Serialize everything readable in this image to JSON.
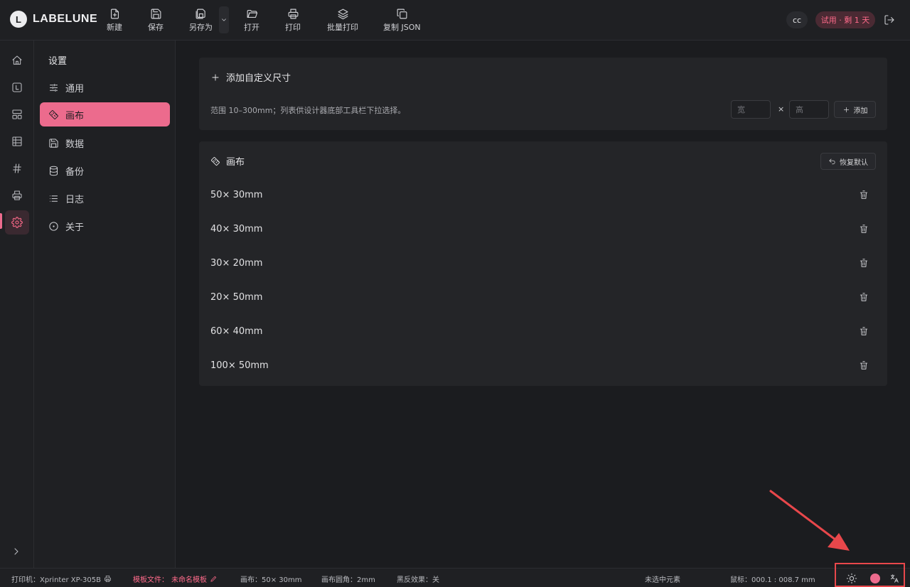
{
  "app": {
    "logo_text": "LABELUNE",
    "logo_letter": "L"
  },
  "toolbar": {
    "new_label": "新建",
    "save_label": "保存",
    "save_as_label": "另存为",
    "open_label": "打开",
    "print_label": "打印",
    "batch_print_label": "批量打印",
    "copy_json_label": "复制 JSON"
  },
  "header": {
    "avatar_text": "cc",
    "trial_badge": "试用 · 剩 1 天"
  },
  "sidebar": {
    "title": "设置",
    "items": [
      {
        "label": "通用",
        "icon": "sliders-icon"
      },
      {
        "label": "画布",
        "icon": "ruler-icon"
      },
      {
        "label": "数据",
        "icon": "save-icon"
      },
      {
        "label": "备份",
        "icon": "database-icon"
      },
      {
        "label": "日志",
        "icon": "list-icon"
      },
      {
        "label": "关于",
        "icon": "info-circle-icon"
      }
    ],
    "active_index": 1
  },
  "custom_size": {
    "title": "添加自定义尺寸",
    "hint": "范围 10–300mm；列表供设计器底部工具栏下拉选择。",
    "width_placeholder": "宽",
    "height_placeholder": "高",
    "times": "×",
    "add_label": "添加"
  },
  "canvas_section": {
    "title": "画布",
    "restore_label": "恢复默认",
    "sizes": [
      "50× 30mm",
      "40× 30mm",
      "30× 20mm",
      "20× 50mm",
      "60× 40mm",
      "100× 50mm"
    ]
  },
  "status_bar": {
    "printer": "打印机：Xprinter XP-305B",
    "template_prefix": "模板文件：",
    "template_name": "未命名模板",
    "canvas": "画布：50× 30mm",
    "corner": "画布圆角：2mm",
    "invert": "黑反效果：关",
    "selection": "未选中元素",
    "mouse": "鼠标：000.1 : 008.7 mm"
  },
  "colors": {
    "accent": "#ec6b8d",
    "annotation": "#e8474b"
  }
}
